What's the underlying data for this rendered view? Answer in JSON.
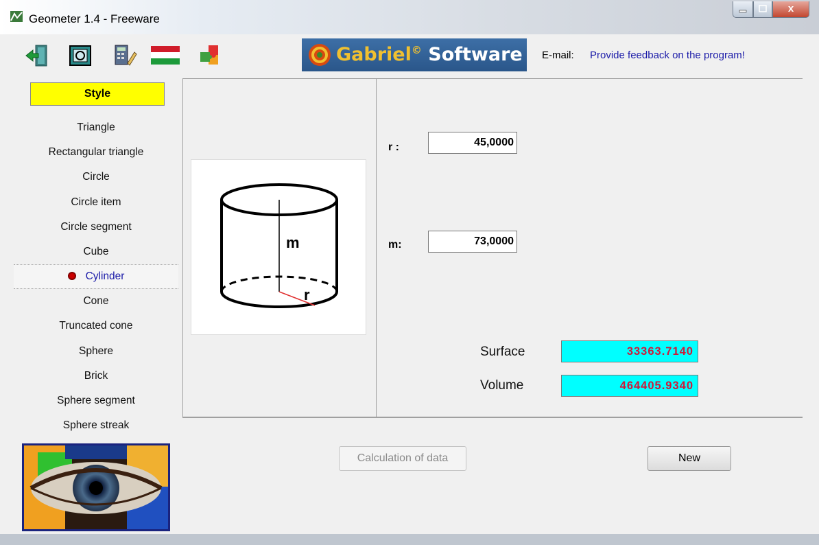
{
  "window": {
    "title": "Geometer 1.4 - Freeware",
    "close_label": "x"
  },
  "toolbar": {
    "icons": [
      "exit-icon",
      "window-icon",
      "calculator-edit-icon",
      "hungarian-flag-icon",
      "puzzle-icon"
    ],
    "logo_text_prefix": "Gabriel",
    "logo_reg": "©",
    "logo_text_suffix": " Software",
    "email_label": "E-mail:",
    "feedback_link": "Provide feedback on the program!"
  },
  "sidebar": {
    "header": "Style",
    "shapes": [
      "Triangle",
      "Rectangular triangle",
      "Circle",
      "Circle item",
      "Circle segment",
      "Cube",
      "Cylinder",
      "Cone",
      "Truncated cone",
      "Sphere",
      "Brick",
      "Sphere segment",
      "Sphere streak"
    ],
    "selected": "Cylinder"
  },
  "figure": {
    "labels": {
      "height": "m",
      "radius": "r"
    }
  },
  "inputs": {
    "r": {
      "label": "r :",
      "value": "45,0000"
    },
    "m": {
      "label": "m:",
      "value": "73,0000"
    }
  },
  "results": {
    "surface": {
      "label": "Surface",
      "value": "33363.7140"
    },
    "volume": {
      "label": "Volume",
      "value": "464405.9340"
    }
  },
  "buttons": {
    "calc": "Calculation of data",
    "new": "New"
  },
  "colors": {
    "style_header": "#ffff00",
    "result_bg": "#00ffff",
    "result_text": "#cc1a3a",
    "link": "#1a1aa8"
  }
}
